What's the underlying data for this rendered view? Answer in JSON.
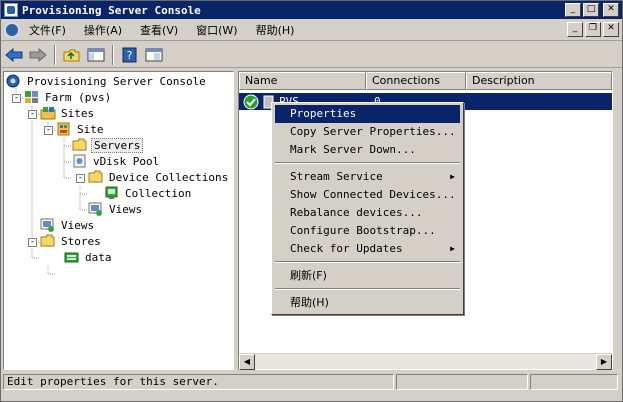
{
  "window": {
    "title": "Provisioning Server Console"
  },
  "title_buttons": {
    "minimize": "_",
    "maximize": "□",
    "close": "✕"
  },
  "menubar": {
    "items": [
      "文件(F)",
      "操作(A)",
      "查看(V)",
      "窗口(W)",
      "帮助(H)"
    ]
  },
  "mdi_buttons": {
    "minimize": "_",
    "restore": "❐",
    "close": "✕"
  },
  "tree": {
    "root": "Provisioning Server Console",
    "farm": "Farm (pvs)",
    "sites": "Sites",
    "site": "Site",
    "servers": "Servers",
    "vdisk_pool": "vDisk Pool",
    "device_collections": "Device Collections",
    "collection": "Collection",
    "site_views": "Views",
    "views": "Views",
    "stores": "Stores",
    "data": "data"
  },
  "list": {
    "columns": [
      "Name",
      "Connections",
      "Description"
    ],
    "rows": [
      {
        "name": "PVS",
        "connections": "0",
        "description": ""
      }
    ]
  },
  "context_menu": {
    "items": [
      {
        "label": "Properties",
        "highlighted": true
      },
      {
        "label": "Copy Server Properties..."
      },
      {
        "label": "Mark Server Down..."
      },
      {
        "label": "Stream Service",
        "submenu": true
      },
      {
        "label": "Show Connected Devices..."
      },
      {
        "label": "Rebalance devices..."
      },
      {
        "label": "Configure Bootstrap..."
      },
      {
        "label": "Check for Updates",
        "submenu": true
      },
      {
        "label": "刷新(F)"
      },
      {
        "label": "帮助(H)"
      }
    ],
    "submenu_arrow": "▶"
  },
  "statusbar": {
    "text": "Edit properties for this server."
  },
  "scroll": {
    "left_arrow": "◀",
    "right_arrow": "▶"
  },
  "colors": {
    "titlebar": "#0a246a",
    "selection": "#0a246a",
    "chrome": "#d4d0c8"
  },
  "icons": {
    "back": "back-arrow-icon",
    "forward": "forward-arrow-icon",
    "up": "up-folder-icon",
    "show_tree": "show-tree-icon",
    "help": "help-icon",
    "view": "view-icon"
  }
}
